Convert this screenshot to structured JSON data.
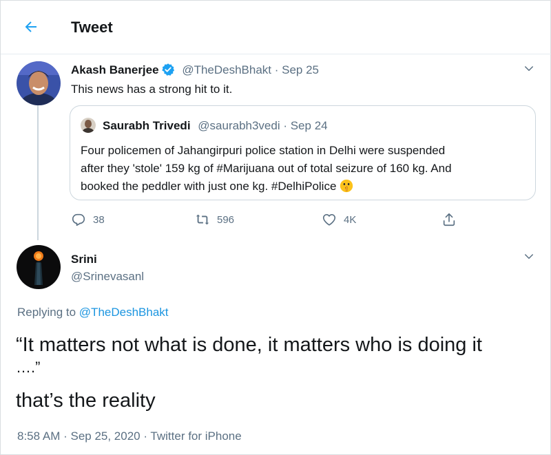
{
  "header": {
    "title": "Tweet"
  },
  "parent_tweet": {
    "author_name": "Akash Banerjee",
    "handle_date": "@TheDeshBhakt · Sep 25",
    "text": "This news has a strong hit to it.",
    "quoted": {
      "author_name": "Saurabh Trivedi",
      "handle_date": "@saurabh3vedi · Sep 24",
      "lines": [
        "Four policemen of Jahangirpuri police station in Delhi were suspended",
        "after they 'stole' 159 kg of #Marijuana out of total seizure of 160 kg. And",
        "booked the peddler with just one kg. #DelhiPolice"
      ]
    },
    "actions": {
      "replies": "38",
      "retweets": "596",
      "likes": "4K"
    }
  },
  "main_tweet": {
    "author_name": "Srini",
    "handle": "@Srinevasanl",
    "replying_prefix": "Replying to",
    "replying_handle": "@TheDeshBhakt",
    "text_lines": [
      "“It matters not what is done, it matters who is doing it",
      "….”",
      "that’s the reality"
    ],
    "meta": "8:58 AM · Sep 25, 2020 · Twitter for iPhone"
  },
  "colors": {
    "accent": "#1da1f2",
    "muted": "#5b7083",
    "border": "#ccd6dd"
  },
  "icons": [
    "back-arrow-icon",
    "verified-badge-icon",
    "chevron-down-icon",
    "reply-icon",
    "retweet-icon",
    "like-icon",
    "share-icon",
    "shushing-face-emoji"
  ]
}
